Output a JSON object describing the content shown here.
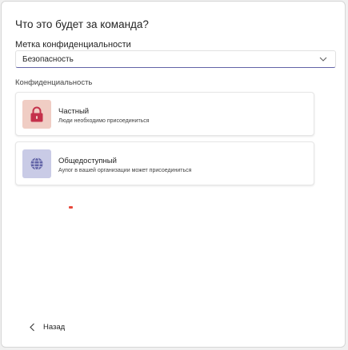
{
  "dialog": {
    "title": "Что это будет за команда?"
  },
  "sensitivity": {
    "label": "Метка конфиденциальности",
    "selected_value": "Безопасность",
    "icon": "chevron-down-icon"
  },
  "privacy": {
    "section_label": "Конфиденциальность",
    "options": [
      {
        "title": "Частный",
        "description": "Люди необходимо присоединиться",
        "icon": "lock-icon",
        "icon_bg": "#f0cdc4",
        "icon_color": "#c4314b"
      },
      {
        "title": "Общедоступный",
        "description": "Аупог в вашей организации может присоединиться",
        "icon": "globe-icon",
        "icon_bg": "#c9cbe6",
        "icon_color": "#6264a7"
      }
    ]
  },
  "footer": {
    "back_label": "Назад",
    "back_icon": "chevron-left-icon"
  },
  "colors": {
    "accent": "#6264a7",
    "marker": "#e8483b"
  }
}
